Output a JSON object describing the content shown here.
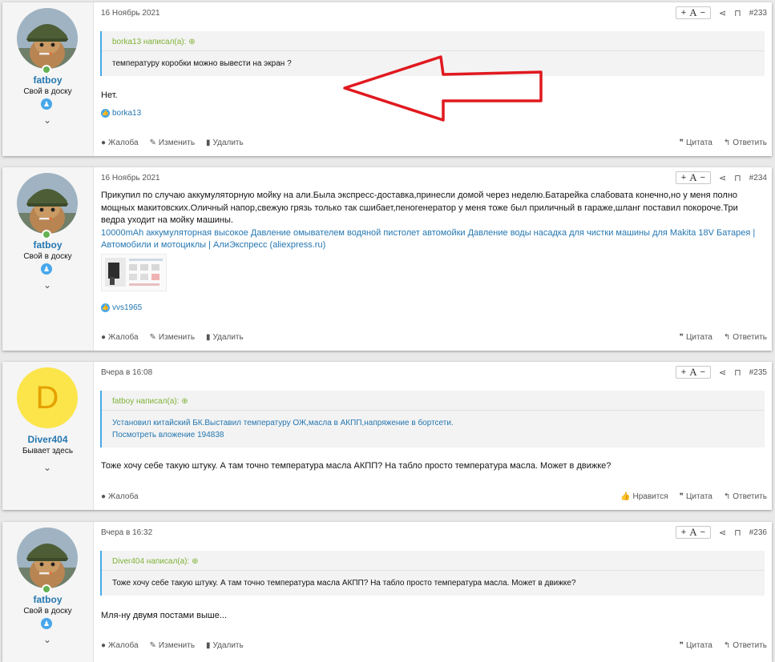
{
  "posts": [
    {
      "user": {
        "name": "fatboy",
        "title": "Свой в доску"
      },
      "date": "16 Ноябрь 2021",
      "number": "#233",
      "quote": {
        "author": "borka13 написал(а):",
        "text": "температуру коробки можно вывести на экран ?"
      },
      "message": "Нет.",
      "likes": "borka13",
      "footer": {
        "report": "Жалоба",
        "edit": "Изменить",
        "delete": "Удалить",
        "quote": "Цитата",
        "reply": "Ответить"
      }
    },
    {
      "user": {
        "name": "fatboy",
        "title": "Свой в доску"
      },
      "date": "16 Ноябрь 2021",
      "number": "#234",
      "message": "Прикупил по случаю аккумуляторную мойку на али.Была экспресс-доставка,принесли домой через неделю.Батарейка слабовата конечно,но у меня полно мощных макитовских.Оличный напор,свежую грязь только так сшибает,пеногенератор у меня тоже был приличный в гараже,шланг поставил покороче.Три ведра уходит на мойку машины.",
      "link": "10000mAh аккумуляторная высокое Давление омывателем водяной пистолет автомойки Давление воды насадка для чистки машины для Makita 18V Батарея | Автомобили и мотоциклы | АлиЭкспресс (aliexpress.ru)",
      "likes": "vvs1965",
      "footer": {
        "report": "Жалоба",
        "edit": "Изменить",
        "delete": "Удалить",
        "quote": "Цитата",
        "reply": "Ответить"
      }
    },
    {
      "user": {
        "name": "Diver404",
        "title": "Бывает здесь",
        "initial": "D"
      },
      "date": "Вчера в 16:08",
      "number": "#235",
      "quote": {
        "author": "fatboy написал(а):",
        "text": "Установил китайский БК.Выставил температуру ОЖ,масла в АКПП,напряжение в бортсети.",
        "attachment": "Посмотреть вложение 194838"
      },
      "message": "Тоже хочу себе такую штуку. А там точно температура масла АКПП? На табло просто температура масла. Может в движке?",
      "footer": {
        "report": "Жалоба",
        "like": "Нравится",
        "quote": "Цитата",
        "reply": "Ответить"
      }
    },
    {
      "user": {
        "name": "fatboy",
        "title": "Свой в доску"
      },
      "date": "Вчера в 16:32",
      "number": "#236",
      "quote": {
        "author": "Diver404 написал(а):",
        "text": "Тоже хочу себе такую штуку. А там точно температура масла АКПП? На табло просто температура масла. Может в движке?"
      },
      "message": "Мля-ну двумя постами выше...",
      "footer": {
        "report": "Жалоба",
        "edit": "Изменить",
        "delete": "Удалить",
        "quote": "Цитата",
        "reply": "Ответить"
      }
    }
  ],
  "toolbar": {
    "font_small": "A",
    "font_plus": "+",
    "font_minus": "−"
  },
  "colors": {
    "link": "#2577b1",
    "quote_author": "#7fb236",
    "annotation_arrow": "#e0191f",
    "online": "#63b153"
  }
}
